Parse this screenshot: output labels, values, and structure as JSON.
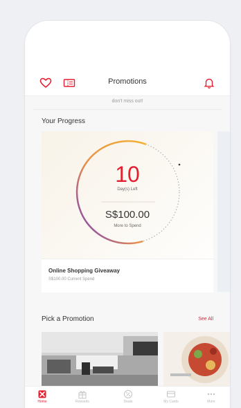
{
  "header": {
    "title": "Promotions",
    "subtitle": "don't miss out!"
  },
  "progress": {
    "section_title": "Your Progress",
    "days_left": "10",
    "days_label": "Day(s) Left",
    "amount": "S$100.00",
    "amount_label": "More to Spend",
    "completion": 0.6,
    "card_title": "Online Shopping Giveaway",
    "card_sub": "S$100.00 Current Spend"
  },
  "promotions": {
    "section_title": "Pick a Promotion",
    "see_all": "See All"
  },
  "tabs": [
    {
      "label": "Home",
      "icon": "home-icon",
      "active": true
    },
    {
      "label": "Rewards",
      "icon": "gift-icon",
      "active": false
    },
    {
      "label": "Deals",
      "icon": "percent-icon",
      "active": false
    },
    {
      "label": "My Cards",
      "icon": "card-icon",
      "active": false
    },
    {
      "label": "More",
      "icon": "more-icon",
      "active": false
    }
  ],
  "colors": {
    "accent": "#e41e2f",
    "ring_start": "#f2b233",
    "ring_end": "#6a35c9"
  }
}
